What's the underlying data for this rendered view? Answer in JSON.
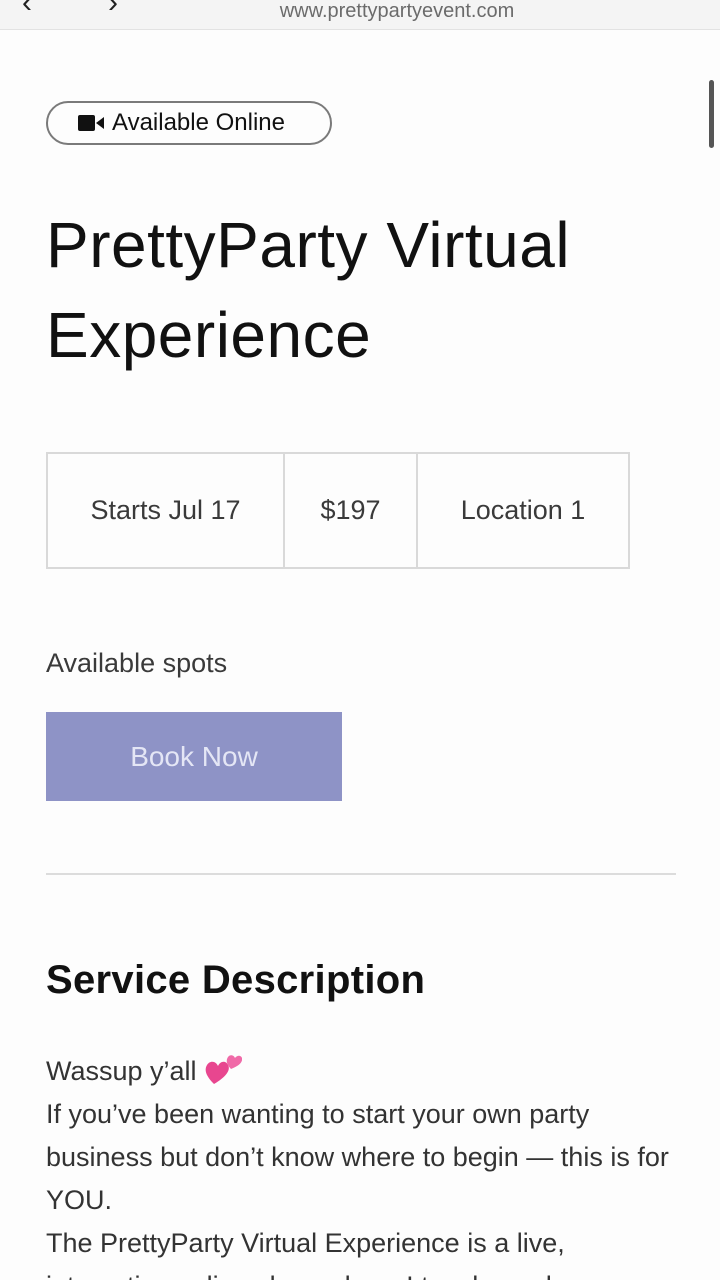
{
  "browser": {
    "url": "www.prettypartyevent.com"
  },
  "badge": {
    "icon": "video-camera-icon",
    "label": "Available Online"
  },
  "service": {
    "title": "PrettyParty Virtual Experience",
    "start": "Starts Jul 17",
    "price": "$197",
    "location": "Location 1",
    "availability": "Available spots",
    "book_label": "Book Now"
  },
  "description": {
    "heading": "Service Description",
    "greeting": "Wassup y’all",
    "greeting_icon": "two-hearts-icon",
    "line1": "If you’ve been wanting to start your own party business but don’t know where to begin — this is for YOU.",
    "line2": "The PrettyParty Virtual Experience is a live, interactive online class where I teach you how"
  },
  "colors": {
    "book_button": "#8e93c6",
    "badge_border": "#7a7a7a",
    "heart": "#e8468f"
  }
}
